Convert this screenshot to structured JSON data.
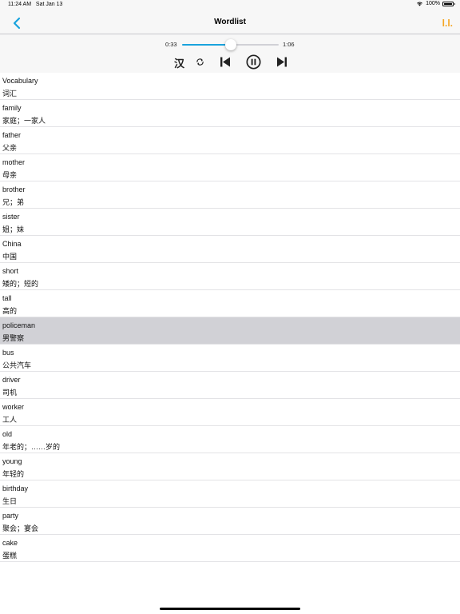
{
  "status_bar": {
    "time": "11:24 AM",
    "date": "Sat Jan 13",
    "battery": "100%",
    "wifi_icon": "wifi-icon",
    "battery_icon": "battery-icon"
  },
  "nav": {
    "title": "Wordlist",
    "back_icon": "chevron-left-icon",
    "font_button_label": "l.l.",
    "accent_color": "#f5a623",
    "back_color": "#1aa3dd"
  },
  "player": {
    "current_time": "0:33",
    "total_time": "1:06",
    "progress": 0.5,
    "han_label": "汉",
    "accent_color": "#1aa3dd",
    "icons": [
      "repeat-icon",
      "skip-back-icon",
      "pause-icon",
      "skip-forward-icon"
    ]
  },
  "words": [
    {
      "word": "Vocabulary",
      "meaning": "词汇"
    },
    {
      "word": "family",
      "meaning": "家庭；一家人"
    },
    {
      "word": "father",
      "meaning": "父亲"
    },
    {
      "word": "mother",
      "meaning": "母亲"
    },
    {
      "word": "brother",
      "meaning": "兄；弟"
    },
    {
      "word": "sister",
      "meaning": "姐；妹"
    },
    {
      "word": "China",
      "meaning": "中国"
    },
    {
      "word": "short",
      "meaning": "矮的；短的"
    },
    {
      "word": "tall",
      "meaning": "高的"
    },
    {
      "word": "policeman",
      "meaning": "男警察"
    },
    {
      "word": "bus",
      "meaning": "公共汽车"
    },
    {
      "word": "driver",
      "meaning": "司机"
    },
    {
      "word": "worker",
      "meaning": "工人"
    },
    {
      "word": "old",
      "meaning": "年老的；……岁的"
    },
    {
      "word": "young",
      "meaning": "年轻的"
    },
    {
      "word": "birthday",
      "meaning": "生日"
    },
    {
      "word": "party",
      "meaning": "聚会；宴会"
    },
    {
      "word": "cake",
      "meaning": "蛋糕"
    }
  ],
  "selected_index": 9
}
